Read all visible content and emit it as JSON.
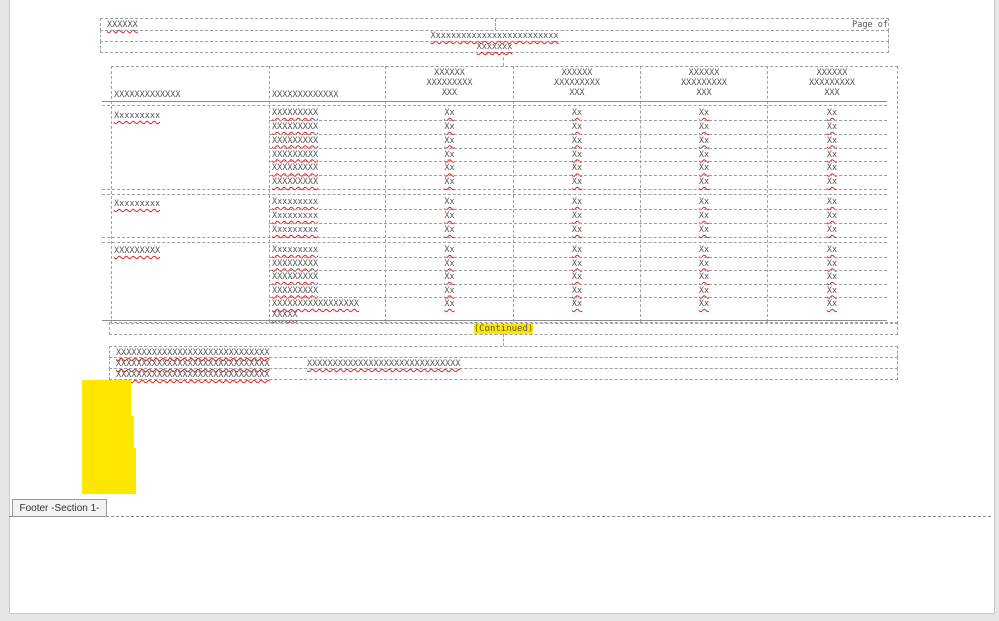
{
  "header": {
    "left_text": "XXXXXX",
    "right_text": "Page  of",
    "title": "Xxxxxxxxxxxxxxxxxxxxxxxxx",
    "subtitle": "Xxxxxxx"
  },
  "table": {
    "col_headers": [
      "XXXXXXXXXXXXX",
      "XXXXXXXXXXXXX",
      [
        "XXXXXX",
        "XXXXXXXXX",
        "XXX"
      ],
      [
        "XXXXXX",
        "XXXXXXXXX",
        "XXX"
      ],
      [
        "XXXXXX",
        "XXXXXXXXX",
        "XXX"
      ],
      [
        "XXXXXX",
        "XXXXXXXXX",
        "XXX"
      ]
    ],
    "groups": [
      {
        "label": "Xxxxxxxxx",
        "rows": [
          "XXXXXXXXX",
          "XXXXXXXXX",
          "XXXXXXXXX",
          "XXXXXXXXX",
          "XXXXXXXXX",
          "XXXXXXXXX"
        ]
      },
      {
        "label": "Xxxxxxxxx",
        "rows": [
          "Xxxxxxxxx",
          "Xxxxxxxxx",
          "Xxxxxxxxx"
        ]
      },
      {
        "label": "XXXXXXXXX",
        "rows": [
          "Xxxxxxxxx",
          "XXXXXXXXX",
          "XXXXXXXXX",
          "XXXXXXXXX",
          "XXXXXXXXXXXXXXXXX"
        ]
      }
    ],
    "wrap_extra": "XXXXX",
    "value": "Xx",
    "continued": "(Continued)"
  },
  "notes": {
    "line1": "XXXXXXXXXXXXXXXXXXXXXXXXXXXXXX",
    "line2a": "XXXXXXXXXXXXXXXXXXXXXXXXXXXXXX",
    "line2b": "XXXXXXXXXXXXXXXXXXXXXXXXXXXXXX",
    "line3": "XXXXXXXXXXXXXXXXXXXXXXXXXXXXXX"
  },
  "footer": {
    "tab_label": "Footer -Section 1-"
  },
  "colors": {
    "highlight": "#ffe600",
    "spell_underline": "#e02020"
  }
}
